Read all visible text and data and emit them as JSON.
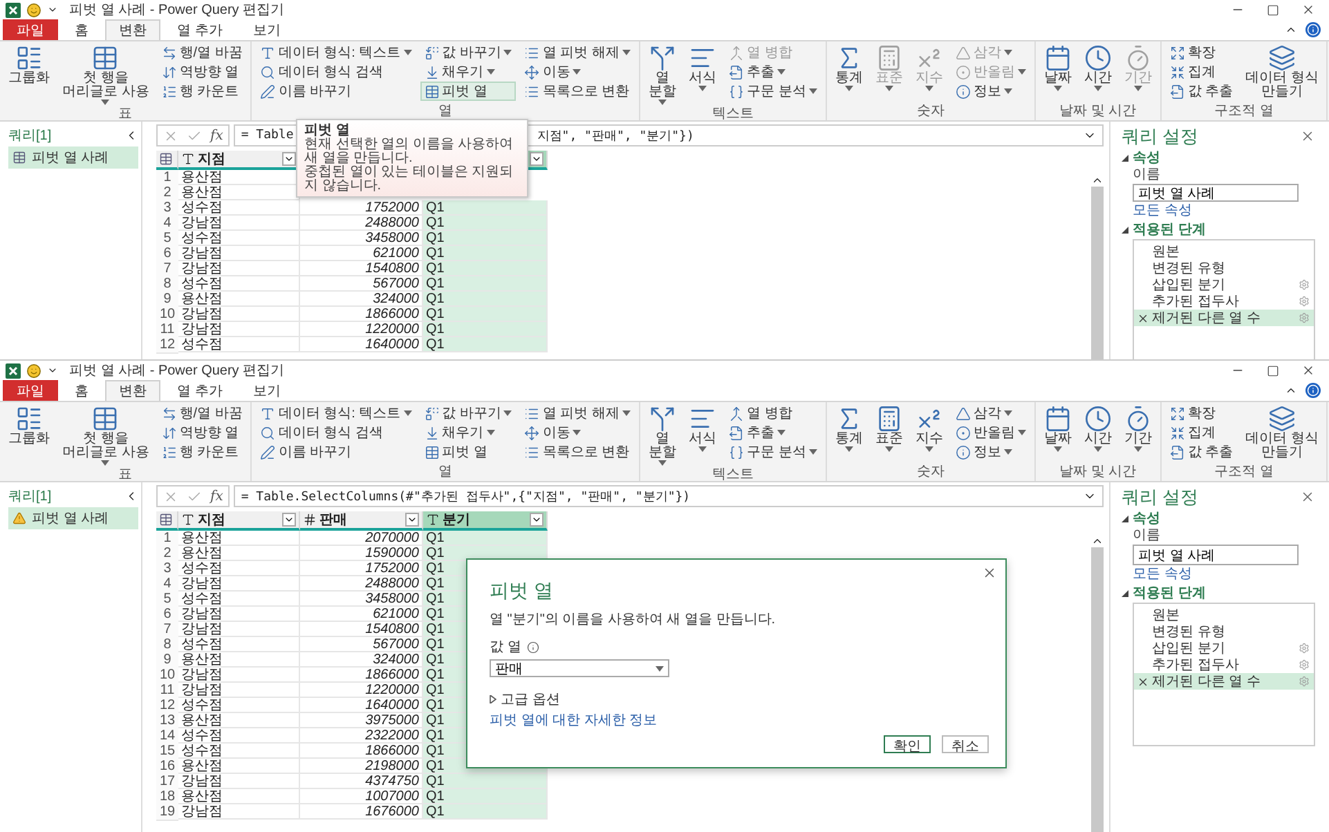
{
  "windows": [
    {
      "title": "피벗 열 사례 - Power Query 편집기",
      "tabs": [
        {
          "label": "파일",
          "kind": "file",
          "selected": false
        },
        {
          "label": "홈",
          "kind": "tab",
          "selected": false
        },
        {
          "label": "변환",
          "kind": "tab",
          "selected": true
        },
        {
          "label": "열 추가",
          "kind": "tab",
          "selected": false
        },
        {
          "label": "보기",
          "kind": "tab",
          "selected": false
        }
      ],
      "ribbon": [
        {
          "label": "표",
          "items": [
            {
              "kind": "large",
              "label": "그룹화",
              "dropdown": false,
              "disabled": false,
              "hovered": false
            },
            {
              "kind": "large",
              "label": "첫 행을\n머리글로 사용",
              "dropdown": true,
              "disabled": false,
              "hovered": false
            },
            {
              "kind": "small",
              "label": "행/열 바꿈",
              "dropdown": false,
              "disabled": false,
              "hovered": false
            },
            {
              "kind": "small",
              "label": "역방향 열",
              "dropdown": false,
              "disabled": false,
              "hovered": false
            },
            {
              "kind": "small",
              "label": "행 카운트",
              "dropdown": false,
              "disabled": false,
              "hovered": false
            }
          ]
        },
        {
          "label": "열",
          "items": [
            {
              "kind": "small",
              "label": "데이터 형식: 텍스트",
              "dropdown": true,
              "disabled": false,
              "hovered": false
            },
            {
              "kind": "small",
              "label": "데이터 형식 검색",
              "dropdown": false,
              "disabled": false,
              "hovered": false
            },
            {
              "kind": "small",
              "label": "이름 바꾸기",
              "dropdown": false,
              "disabled": false,
              "hovered": false
            },
            {
              "kind": "small",
              "label": "값 바꾸기",
              "dropdown": true,
              "disabled": false,
              "hovered": false
            },
            {
              "kind": "small",
              "label": "채우기",
              "dropdown": true,
              "disabled": false,
              "hovered": false
            },
            {
              "kind": "small",
              "label": "피벗 열",
              "dropdown": false,
              "disabled": false,
              "hovered": true
            },
            {
              "kind": "small",
              "label": "열 피벗 해제",
              "dropdown": true,
              "disabled": false,
              "hovered": false
            },
            {
              "kind": "small",
              "label": "이동",
              "dropdown": true,
              "disabled": false,
              "hovered": false
            },
            {
              "kind": "small",
              "label": "목록으로 변환",
              "dropdown": false,
              "disabled": false,
              "hovered": false
            }
          ]
        },
        {
          "label": "텍스트",
          "items": [
            {
              "kind": "large",
              "label": "열\n분할",
              "dropdown": true,
              "disabled": false,
              "hovered": false
            },
            {
              "kind": "large",
              "label": "서식",
              "dropdown": true,
              "disabled": false,
              "hovered": false
            },
            {
              "kind": "small",
              "label": "열 병합",
              "dropdown": false,
              "disabled": true,
              "hovered": false
            },
            {
              "kind": "small",
              "label": "추출",
              "dropdown": true,
              "disabled": false,
              "hovered": false
            },
            {
              "kind": "small",
              "label": "구문 분석",
              "dropdown": true,
              "disabled": false,
              "hovered": false
            }
          ]
        },
        {
          "label": "숫자",
          "items": [
            {
              "kind": "large",
              "label": "통계",
              "dropdown": true,
              "disabled": false,
              "hovered": false
            },
            {
              "kind": "large",
              "label": "표준",
              "dropdown": true,
              "disabled": true,
              "hovered": false
            },
            {
              "kind": "large",
              "label": "지수",
              "dropdown": true,
              "disabled": true,
              "hovered": false
            },
            {
              "kind": "small",
              "label": "삼각",
              "dropdown": true,
              "disabled": true,
              "hovered": false
            },
            {
              "kind": "small",
              "label": "반올림",
              "dropdown": true,
              "disabled": true,
              "hovered": false
            },
            {
              "kind": "small",
              "label": "정보",
              "dropdown": true,
              "disabled": false,
              "hovered": false
            }
          ]
        },
        {
          "label": "날짜 및 시간",
          "items": [
            {
              "kind": "large",
              "label": "날짜",
              "dropdown": true,
              "disabled": false,
              "hovered": false
            },
            {
              "kind": "large",
              "label": "시간",
              "dropdown": true,
              "disabled": false,
              "hovered": false
            },
            {
              "kind": "large",
              "label": "기간",
              "dropdown": true,
              "disabled": true,
              "hovered": false
            }
          ]
        },
        {
          "label": "구조적 열",
          "items": [
            {
              "kind": "small",
              "label": "확장",
              "dropdown": false,
              "disabled": false,
              "hovered": false
            },
            {
              "kind": "small",
              "label": "집계",
              "dropdown": false,
              "disabled": false,
              "hovered": false
            },
            {
              "kind": "small",
              "label": "값 추출",
              "dropdown": false,
              "disabled": false,
              "hovered": false
            },
            {
              "kind": "large",
              "label": "데이터 형식\n만들기",
              "dropdown": false,
              "disabled": false,
              "hovered": false
            }
          ]
        }
      ],
      "queries": {
        "heading": "쿼리[1]",
        "items": [
          {
            "label": "피벗 열 사례",
            "selected": true,
            "warning": false
          }
        ]
      },
      "formula": {
        "label": "fx",
        "parts": [
          "= Table",
          "지점\", \"판매\", \"분기\"})"
        ]
      },
      "table": {
        "columns": [
          {
            "label": "지점",
            "kind": "text",
            "filter": true,
            "selected": false
          },
          {},
          {
            "filter": true,
            "selected": true
          }
        ],
        "rows": [
          {
            "index": "1",
            "cells": [
              "용산점"
            ]
          },
          {
            "index": "2",
            "cells": [
              "용산점"
            ]
          },
          {
            "index": "3",
            "cells": [
              "성수점",
              "1752000",
              "Q1"
            ]
          },
          {
            "index": "4",
            "cells": [
              "강남점",
              "2488000",
              "Q1"
            ]
          },
          {
            "index": "5",
            "cells": [
              "성수점",
              "3458000",
              "Q1"
            ]
          },
          {
            "index": "6",
            "cells": [
              "강남점",
              "621000",
              "Q1"
            ]
          },
          {
            "index": "7",
            "cells": [
              "강남점",
              "1540800",
              "Q1"
            ]
          },
          {
            "index": "8",
            "cells": [
              "성수점",
              "567000",
              "Q1"
            ]
          },
          {
            "index": "9",
            "cells": [
              "용산점",
              "324000",
              "Q1"
            ]
          },
          {
            "index": "10",
            "cells": [
              "강남점",
              "1866000",
              "Q1"
            ]
          },
          {
            "index": "11",
            "cells": [
              "강남점",
              "1220000",
              "Q1"
            ]
          },
          {
            "index": "12",
            "cells": [
              "성수점",
              "1640000",
              "Q1"
            ]
          }
        ]
      },
      "settings": {
        "title": "쿼리 설정",
        "properties_heading": "속성",
        "name_label": "이름",
        "name_value": "피벗 열 사례",
        "all_properties": "모든 속성",
        "steps_heading": "적용된 단계",
        "steps": [
          {
            "label": "원본",
            "selected": false,
            "settings": false
          },
          {
            "label": "변경된 유형",
            "selected": false,
            "settings": false
          },
          {
            "label": "삽입된 분기",
            "selected": false,
            "settings": true
          },
          {
            "label": "추가된 접두사",
            "selected": false,
            "settings": true
          },
          {
            "label": "제거된 다른 열 수",
            "selected": true,
            "settings": true
          }
        ]
      },
      "tooltip": {
        "title": "피벗 열",
        "lines": [
          "현재 선택한 열의 이름을 사용하여",
          "새 열을 만듭니다.",
          "중첩된 열이 있는 테이블은 지원되",
          "지 않습니다."
        ]
      }
    },
    {
      "title": "피벗 열 사례 - Power Query 편집기",
      "tabs": [
        {
          "label": "파일",
          "kind": "file",
          "selected": false
        },
        {
          "label": "홈",
          "kind": "tab",
          "selected": false
        },
        {
          "label": "변환",
          "kind": "tab",
          "selected": true
        },
        {
          "label": "열 추가",
          "kind": "tab",
          "selected": false
        },
        {
          "label": "보기",
          "kind": "tab",
          "selected": false
        }
      ],
      "ribbon": [
        {
          "label": "표",
          "items": [
            {
              "kind": "large",
              "label": "그룹화",
              "dropdown": false,
              "disabled": false,
              "hovered": false
            },
            {
              "kind": "large",
              "label": "첫 행을\n머리글로 사용",
              "dropdown": true,
              "disabled": false,
              "hovered": false
            },
            {
              "kind": "small",
              "label": "행/열 바꿈",
              "dropdown": false,
              "disabled": false,
              "hovered": false
            },
            {
              "kind": "small",
              "label": "역방향 열",
              "dropdown": false,
              "disabled": false,
              "hovered": false
            },
            {
              "kind": "small",
              "label": "행 카운트",
              "dropdown": false,
              "disabled": false,
              "hovered": false
            }
          ]
        },
        {
          "label": "열",
          "items": [
            {
              "kind": "small",
              "label": "데이터 형식: 텍스트",
              "dropdown": true,
              "disabled": false,
              "hovered": false
            },
            {
              "kind": "small",
              "label": "데이터 형식 검색",
              "dropdown": false,
              "disabled": false,
              "hovered": false
            },
            {
              "kind": "small",
              "label": "이름 바꾸기",
              "dropdown": false,
              "disabled": false,
              "hovered": false
            },
            {
              "kind": "small",
              "label": "값 바꾸기",
              "dropdown": true,
              "disabled": false,
              "hovered": false
            },
            {
              "kind": "small",
              "label": "채우기",
              "dropdown": true,
              "disabled": false,
              "hovered": false
            },
            {
              "kind": "small",
              "label": "피벗 열",
              "dropdown": false,
              "disabled": false,
              "hovered": false
            },
            {
              "kind": "small",
              "label": "열 피벗 해제",
              "dropdown": true,
              "disabled": false,
              "hovered": false
            },
            {
              "kind": "small",
              "label": "이동",
              "dropdown": true,
              "disabled": false,
              "hovered": false
            },
            {
              "kind": "small",
              "label": "목록으로 변환",
              "dropdown": false,
              "disabled": false,
              "hovered": false
            }
          ]
        },
        {
          "label": "텍스트",
          "items": [
            {
              "kind": "large",
              "label": "열\n분할",
              "dropdown": true,
              "disabled": false,
              "hovered": false
            },
            {
              "kind": "large",
              "label": "서식",
              "dropdown": true,
              "disabled": false,
              "hovered": false
            },
            {
              "kind": "small",
              "label": "열 병합",
              "dropdown": false,
              "disabled": false,
              "hovered": false
            },
            {
              "kind": "small",
              "label": "추출",
              "dropdown": true,
              "disabled": false,
              "hovered": false
            },
            {
              "kind": "small",
              "label": "구문 분석",
              "dropdown": true,
              "disabled": false,
              "hovered": false
            }
          ]
        },
        {
          "label": "숫자",
          "items": [
            {
              "kind": "large",
              "label": "통계",
              "dropdown": true,
              "disabled": false,
              "hovered": false
            },
            {
              "kind": "large",
              "label": "표준",
              "dropdown": true,
              "disabled": false,
              "hovered": false
            },
            {
              "kind": "large",
              "label": "지수",
              "dropdown": true,
              "disabled": false,
              "hovered": false
            },
            {
              "kind": "small",
              "label": "삼각",
              "dropdown": true,
              "disabled": false,
              "hovered": false
            },
            {
              "kind": "small",
              "label": "반올림",
              "dropdown": true,
              "disabled": false,
              "hovered": false
            },
            {
              "kind": "small",
              "label": "정보",
              "dropdown": true,
              "disabled": false,
              "hovered": false
            }
          ]
        },
        {
          "label": "날짜 및 시간",
          "items": [
            {
              "kind": "large",
              "label": "날짜",
              "dropdown": true,
              "disabled": false,
              "hovered": false
            },
            {
              "kind": "large",
              "label": "시간",
              "dropdown": true,
              "disabled": false,
              "hovered": false
            },
            {
              "kind": "large",
              "label": "기간",
              "dropdown": true,
              "disabled": false,
              "hovered": false
            }
          ]
        },
        {
          "label": "구조적 열",
          "items": [
            {
              "kind": "small",
              "label": "확장",
              "dropdown": false,
              "disabled": false,
              "hovered": false
            },
            {
              "kind": "small",
              "label": "집계",
              "dropdown": false,
              "disabled": false,
              "hovered": false
            },
            {
              "kind": "small",
              "label": "값 추출",
              "dropdown": false,
              "disabled": false,
              "hovered": false
            },
            {
              "kind": "large",
              "label": "데이터 형식\n만들기",
              "dropdown": false,
              "disabled": false,
              "hovered": false
            }
          ]
        }
      ],
      "queries": {
        "heading": "쿼리[1]",
        "items": [
          {
            "label": "피벗 열 사례",
            "selected": true,
            "warning": true
          }
        ]
      },
      "formula": {
        "label": "fx",
        "parts": [
          "= Table.SelectColumns(#\"추가된 접두사\",{\"지점\", \"판매\", \"분기\"})"
        ]
      },
      "table": {
        "columns": [
          {
            "label": "지점",
            "kind": "text",
            "filter": true,
            "selected": false
          },
          {
            "label": "판매",
            "kind": "number",
            "filter": true,
            "selected": false
          },
          {
            "label": "분기",
            "kind": "text",
            "filter": true,
            "selected": true
          }
        ],
        "rows": [
          {
            "index": "1",
            "cells": [
              "용산점",
              "2070000",
              "Q1"
            ]
          },
          {
            "index": "2",
            "cells": [
              "용산점",
              "1590000",
              "Q1"
            ]
          },
          {
            "index": "3",
            "cells": [
              "성수점",
              "1752000",
              "Q1"
            ]
          },
          {
            "index": "4",
            "cells": [
              "강남점",
              "2488000",
              "Q1"
            ]
          },
          {
            "index": "5",
            "cells": [
              "성수점",
              "3458000",
              "Q1"
            ]
          },
          {
            "index": "6",
            "cells": [
              "강남점",
              "621000",
              "Q1"
            ]
          },
          {
            "index": "7",
            "cells": [
              "강남점",
              "1540800",
              "Q1"
            ]
          },
          {
            "index": "8",
            "cells": [
              "성수점",
              "567000",
              "Q1"
            ]
          },
          {
            "index": "9",
            "cells": [
              "용산점",
              "324000",
              "Q1"
            ]
          },
          {
            "index": "10",
            "cells": [
              "강남점",
              "1866000",
              "Q1"
            ]
          },
          {
            "index": "11",
            "cells": [
              "강남점",
              "1220000",
              "Q1"
            ]
          },
          {
            "index": "12",
            "cells": [
              "성수점",
              "1640000",
              "Q1"
            ]
          },
          {
            "index": "13",
            "cells": [
              "용산점",
              "3975000",
              "Q1"
            ]
          },
          {
            "index": "14",
            "cells": [
              "성수점",
              "2322000",
              "Q1"
            ]
          },
          {
            "index": "15",
            "cells": [
              "성수점",
              "1866000",
              "Q1"
            ]
          },
          {
            "index": "16",
            "cells": [
              "용산점",
              "2198000",
              "Q1"
            ]
          },
          {
            "index": "17",
            "cells": [
              "강남점",
              "4374750",
              "Q1"
            ]
          },
          {
            "index": "18",
            "cells": [
              "용산점",
              "1007000",
              "Q1"
            ]
          },
          {
            "index": "19",
            "cells": [
              "강남점",
              "1676000",
              "Q1"
            ]
          }
        ]
      },
      "settings": {
        "title": "쿼리 설정",
        "properties_heading": "속성",
        "name_label": "이름",
        "name_value": "피벗 열 사례",
        "all_properties": "모든 속성",
        "steps_heading": "적용된 단계",
        "steps": [
          {
            "label": "원본",
            "selected": false,
            "settings": false
          },
          {
            "label": "변경된 유형",
            "selected": false,
            "settings": false
          },
          {
            "label": "삽입된 분기",
            "selected": false,
            "settings": true
          },
          {
            "label": "추가된 접두사",
            "selected": false,
            "settings": true
          },
          {
            "label": "제거된 다른 열 수",
            "selected": true,
            "settings": true
          }
        ]
      },
      "dialog": {
        "title": "피벗 열",
        "description": "열 \"분기\"의 이름을 사용하여 새 열을 만듭니다.",
        "field_label": "값 열",
        "field_value": "판매",
        "advanced": {
          "label": "고급 옵션",
          "expanded": false
        },
        "link": "피벗 열에 대한 자세한 정보",
        "buttons": [
          {
            "label": "확인",
            "primary": true
          },
          {
            "label": "취소",
            "primary": false
          }
        ]
      }
    }
  ]
}
